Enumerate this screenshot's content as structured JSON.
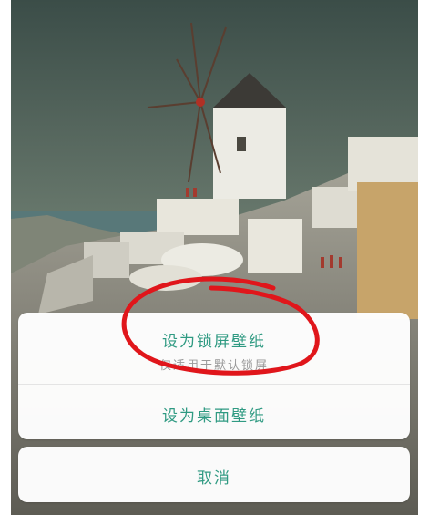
{
  "wallpaper": {
    "description_icon": "santorini-windmill-wallpaper"
  },
  "sheet": {
    "lock_screen_label": "设为锁屏壁纸",
    "lock_screen_hint": "仅适用于默认锁屏",
    "desktop_label": "设为桌面壁纸",
    "cancel_label": "取消"
  },
  "colors": {
    "accent": "#2f9a82",
    "hint": "#9a9a9a",
    "annotation": "#e0161b"
  }
}
